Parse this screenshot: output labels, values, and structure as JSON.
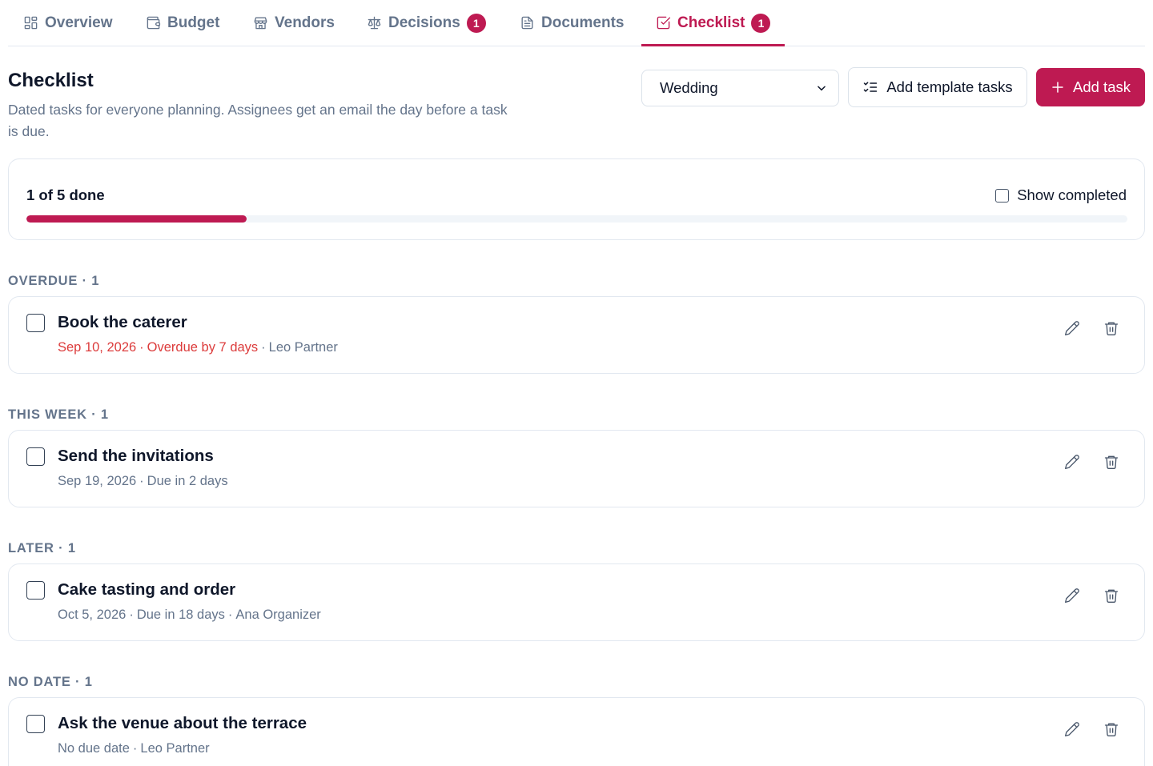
{
  "tabs": [
    {
      "label": "Overview",
      "icon": "layout-grid-icon"
    },
    {
      "label": "Budget",
      "icon": "wallet-icon"
    },
    {
      "label": "Vendors",
      "icon": "store-icon"
    },
    {
      "label": "Decisions",
      "icon": "scale-icon",
      "badge": "1"
    },
    {
      "label": "Documents",
      "icon": "file-text-icon"
    },
    {
      "label": "Checklist",
      "icon": "square-check-icon",
      "badge": "1",
      "active": true
    }
  ],
  "header": {
    "title": "Checklist",
    "description": "Dated tasks for everyone planning. Assignees get an email the day before a task is due.",
    "event_select": "Wedding",
    "template_button": "Add template tasks",
    "add_button": "Add task"
  },
  "progress": {
    "label": "1 of 5 done",
    "done": 1,
    "total": 5,
    "show_completed_label": "Show completed",
    "show_completed_checked": false
  },
  "sections": [
    {
      "label": "OVERDUE · 1",
      "tasks": [
        {
          "title": "Book the caterer",
          "date": "Sep 10, 2026",
          "status": "Overdue by 7 days",
          "assignee": "Leo Partner",
          "overdue": true
        }
      ]
    },
    {
      "label": "THIS WEEK · 1",
      "tasks": [
        {
          "title": "Send the invitations",
          "date": "Sep 19, 2026",
          "status": "Due in 2 days",
          "assignee": ""
        }
      ]
    },
    {
      "label": "LATER · 1",
      "tasks": [
        {
          "title": "Cake tasting and order",
          "date": "Oct 5, 2026",
          "status": "Due in 18 days",
          "assignee": "Ana Organizer"
        }
      ]
    },
    {
      "label": "NO DATE · 1",
      "tasks": [
        {
          "title": "Ask the venue about the terrace",
          "date": "No due date",
          "status": "",
          "assignee": "Leo Partner"
        }
      ]
    }
  ],
  "colors": {
    "accent": "#be1a52",
    "overdue": "#dc3b3b",
    "muted": "#64748b"
  }
}
